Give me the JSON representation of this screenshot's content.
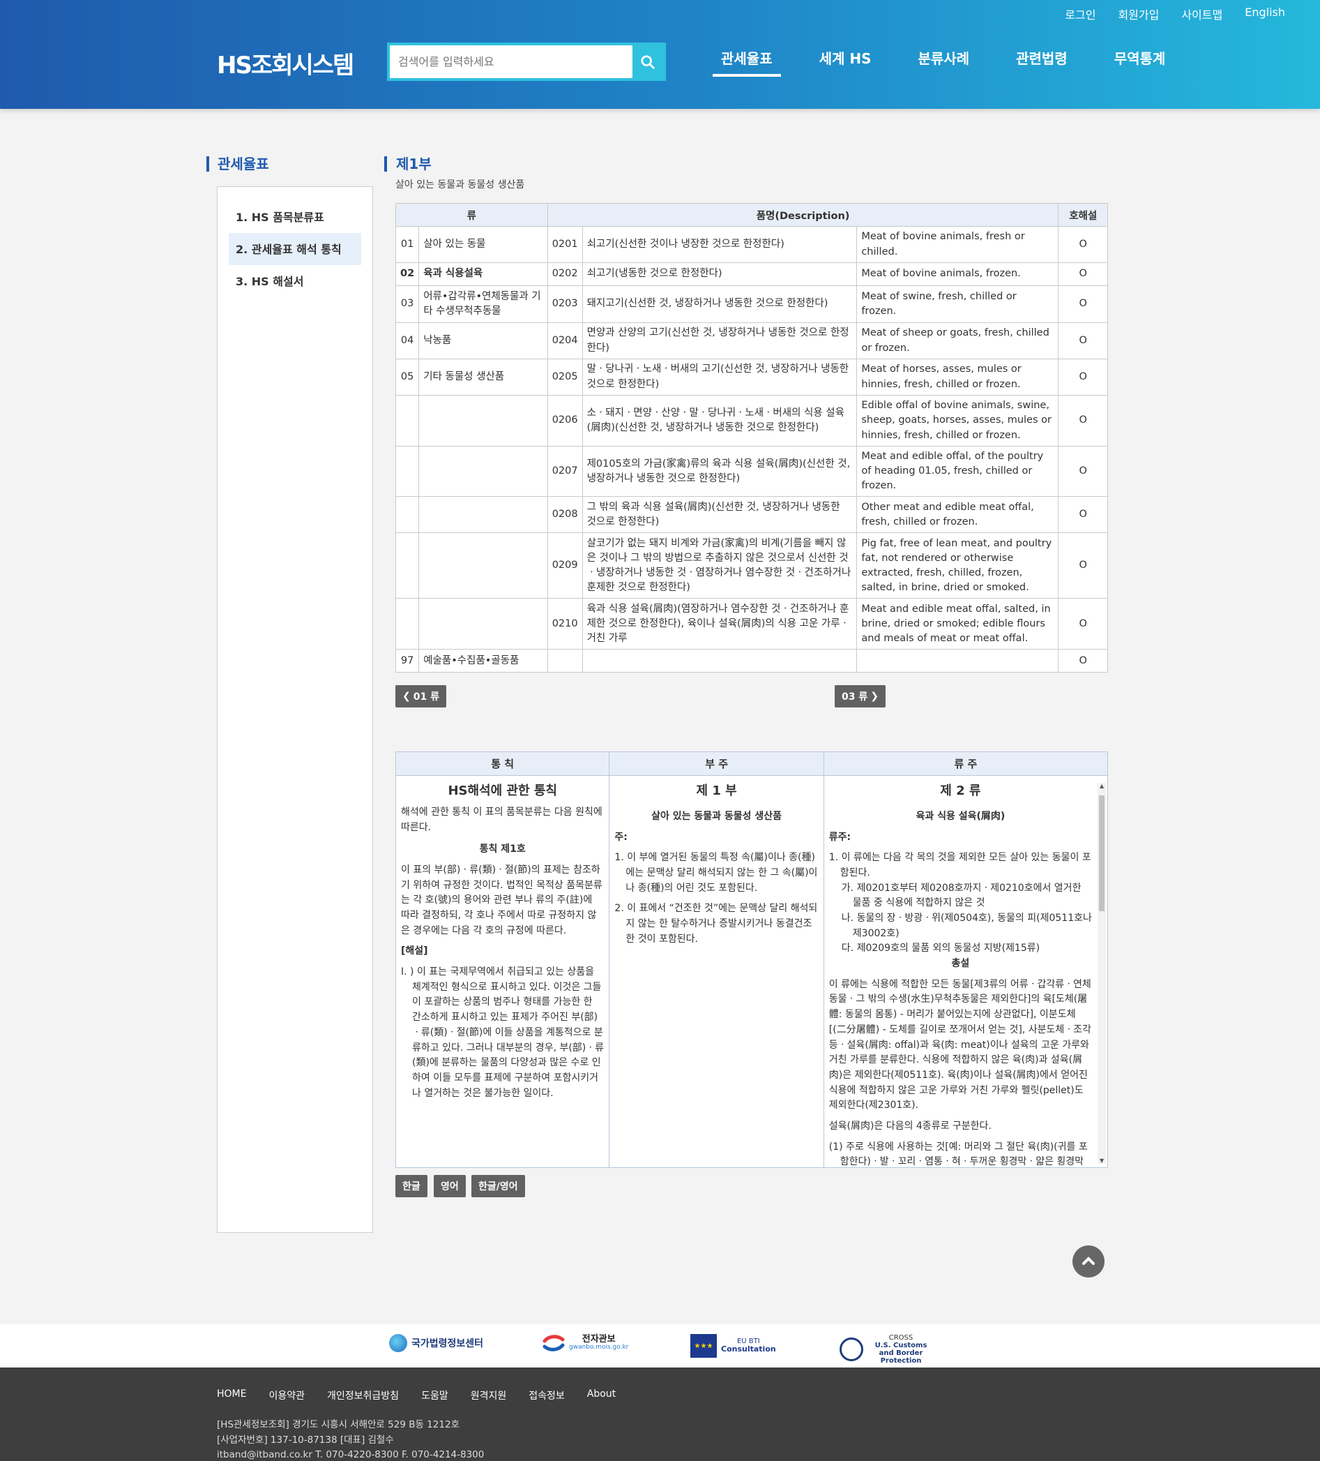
{
  "header": {
    "util": [
      "로그인",
      "회원가입",
      "사이트맵",
      "English"
    ],
    "logo": "HS조회시스템",
    "search_placeholder": "검색어를 입력하세요",
    "nav": [
      "관세율표",
      "세계 HS",
      "분류사례",
      "관련법령",
      "무역통계"
    ]
  },
  "sidebar": {
    "title": "관세율표",
    "items": [
      "1. HS 품목분류표",
      "2. 관세율표 해석 통칙",
      "3. HS 해설서"
    ]
  },
  "section": {
    "title": "제1부",
    "subtitle": "살아 있는 동물과 동물성 생산품"
  },
  "table": {
    "headers": [
      "류",
      "품명(Description)",
      "호해설"
    ],
    "rows": [
      {
        "n": "01",
        "cname": "살아 있는 동물",
        "code": "0201",
        "kr": "쇠고기(신선한 것이나 냉장한 것으로 한정한다)",
        "en": "Meat of bovine animals, fresh or chilled.",
        "mark": "O"
      },
      {
        "n": "02",
        "cname": "육과 식용설육",
        "code": "0202",
        "kr": "쇠고기(냉동한 것으로 한정한다)",
        "en": "Meat of bovine animals, frozen.",
        "mark": "O"
      },
      {
        "n": "03",
        "cname": "어류•갑각류•연체동물과 기타 수생무척추동물",
        "code": "0203",
        "kr": "돼지고기(신선한 것, 냉장하거나 냉동한 것으로 한정한다)",
        "en": "Meat of swine, fresh, chilled or frozen.",
        "mark": "O"
      },
      {
        "n": "04",
        "cname": "낙농품",
        "code": "0204",
        "kr": "면양과 산양의 고기(신선한 것, 냉장하거나 냉동한 것으로 한정한다)",
        "en": "Meat of sheep or goats, fresh, chilled or frozen.",
        "mark": "O"
      },
      {
        "n": "05",
        "cname": "기타 동물성 생산품",
        "code": "0205",
        "kr": "말ㆍ당나귀ㆍ노새ㆍ버새의 고기(신선한 것, 냉장하거나 냉동한 것으로 한정한다)",
        "en": "Meat of horses, asses, mules or hinnies, fresh, chilled or frozen.",
        "mark": "O"
      },
      {
        "n": "",
        "cname": "",
        "code": "0206",
        "kr": "소ㆍ돼지ㆍ면양ㆍ산양ㆍ말ㆍ당나귀ㆍ노새ㆍ버새의 식용 설육(屑肉)(신선한 것, 냉장하거나 냉동한 것으로 한정한다)",
        "en": "Edible offal of bovine animals, swine, sheep, goats, horses, asses, mules or hinnies, fresh, chilled or frozen.",
        "mark": "O"
      },
      {
        "n": "",
        "cname": "",
        "code": "0207",
        "kr": "제0105호의 가금(家禽)류의 육과 식용 설육(屑肉)(신선한 것, 냉장하거나 냉동한 것으로 한정한다)",
        "en": "Meat and edible offal, of the poultry of heading 01.05, fresh, chilled or frozen.",
        "mark": "O"
      },
      {
        "n": "",
        "cname": "",
        "code": "0208",
        "kr": "그 밖의 육과 식용 설육(屑肉)(신선한 것, 냉장하거나 냉동한 것으로 한정한다)",
        "en": "Other meat and edible meat offal, fresh, chilled or frozen.",
        "mark": "O"
      },
      {
        "n": "",
        "cname": "",
        "code": "0209",
        "kr": "살코기가 없는 돼지 비계와 가금(家禽)의 비계(기름을 빼지 않은 것이나 그 밖의 방법으로 추출하지 않은 것으로서 신선한 것ㆍ냉장하거나 냉동한 것ㆍ염장하거나 염수장한 것ㆍ건조하거나 훈제한 것으로 한정한다)",
        "en": "Pig fat, free of lean meat, and poultry fat, not rendered or otherwise extracted, fresh, chilled, frozen, salted, in brine, dried or smoked.",
        "mark": "O"
      },
      {
        "n": "",
        "cname": "",
        "code": "0210",
        "kr": "육과 식용 설육(屑肉)(염장하거나 염수장한 것ㆍ건조하거나 훈제한 것으로 한정한다), 육이나 설육(屑肉)의 식용 고운 가루ㆍ거친 가루",
        "en": "Meat and edible meat offal, salted, in brine, dried or smoked; edible flours and meals of meat or meat offal.",
        "mark": "O"
      },
      {
        "n": "97",
        "cname": "예술품•수집품•골동품",
        "code": "",
        "kr": "",
        "en": "",
        "mark": "O"
      }
    ]
  },
  "pager": {
    "prev": "01 류",
    "next": "03 류"
  },
  "panels": {
    "heads": [
      "통 칙",
      "부 주",
      "류 주"
    ],
    "general": {
      "title": "HS해석에 관한 통칙",
      "intro": "해석에 관한 통칙 이 표의 품목분류는 다음 원칙에 따른다.",
      "rule_title": "통칙 제1호",
      "rule_text": "이 표의 부(部)ㆍ류(類)ㆍ절(節)의 표제는 참조하기 위하여 규정한 것이다. 법적인 목적상 품목분류는 각 호(號)의 용어와 관련 부나 류의 주(註)에 따라 결정하되, 각 호나 주에서 따로 규정하지 않은 경우에는 다음 각 호의 규정에 따른다.",
      "note_label": "[해설]",
      "note_text": "I. ) 이 표는 국제무역에서 취급되고 있는 상품을 체계적인 형식으로 표시하고 있다. 이것은 그들이 포괄하는 상품의 범주나 형태를 가능한 한 간소하게 표시하고 있는 표제가 주어진 부(部)ㆍ류(類)ㆍ절(節)에 이들 상품을 계통적으로 분류하고 있다. 그러나 대부분의 경우, 부(部)ㆍ류(類)에 분류하는 물품의 다양성과 많은 수로 인하여 이들 모두를 표제에 구분하여 포함시키거나 열거하는 것은 불가능한 일이다."
    },
    "section_note": {
      "title": "제 1 부",
      "subtitle": "살아 있는 동물과 동물성 생산품",
      "label": "주:",
      "items": [
        "1. 이 부에 열거된 동물의 특정 속(屬)이나 종(種)에는 문맥상 달리 해석되지 않는 한 그 속(屬)이나 종(種)의 어린 것도 포함된다.",
        "2. 이 표에서 “건조한 것”에는 문맥상 달리 해석되지 않는 한 탈수하거나 증발시키거나 동결건조한 것이 포함된다."
      ]
    },
    "chapter_note": {
      "title": "제 2 류",
      "subtitle": "육과 식용 설육(屑肉)",
      "label": "류주:",
      "item1": "1. 이 류에는 다음 각 목의 것을 제외한 모든 살아 있는 동물이 포함된다.",
      "subitems": [
        "가. 제0201호부터 제0208호까지ㆍ제0210호에서 열거한 물품 중 식용에 적합하지 않은 것",
        "나. 동물의 장ㆍ방광ㆍ위(제0504호), 동물의 피(제0511호나 제3002호)",
        "다. 제0209호의 물품 외의 동물성 지방(제15류)"
      ],
      "general_label": "총설",
      "para1": "이 류에는 식용에 적합한 모든 동물[제3류의 어류ㆍ갑각류ㆍ연체동물ㆍ그 밖의 수생(水生)무척추동물은 제외한다]의 육[도체(屠體: 동물의 몸통) - 머리가 붙어있는지에 상관없다], 이분도체[(二分屠體) - 도체를 길이로 쪼개어서 얻는 것], 사분도체ㆍ조각 등ㆍ설육(屑肉: offal)과 육(肉: meat)이나 설육의 고운 가루와 거친 가루를 분류한다. 식용에 적합하지 않은 육(肉)과 설육(屑肉)은 제외한다(제0511호). 육(肉)이나 설육(屑肉)에서 얻어진 식용에 적합하지 않은 고운 가루와 거친 가루와 펠릿(pellet)도 제외한다(제2301호).",
      "para2": "설육(屑肉)은 다음의 4종류로 구분한다.",
      "para3": "(1) 주로 식용에 사용하는 것[예: 머리와 그 절단 육(肉)(귀를 포함한다)ㆍ발ㆍ꼬리ㆍ염통ㆍ혀ㆍ두꺼운 횡경막ㆍ얇은 횡경막"
    }
  },
  "lang_buttons": [
    "한글",
    "영어",
    "한글/영어"
  ],
  "partners": [
    {
      "name": "국가법령정보센터"
    },
    {
      "name": "전자관보",
      "sub": "gwanbo.mois.go.kr"
    },
    {
      "name": "Consultation",
      "pre": "EU BTI"
    },
    {
      "name": "U.S. Customs and Border Protection",
      "pre": "CROSS"
    }
  ],
  "footer": {
    "nav": [
      "HOME",
      "이용약관",
      "개인정보취급방침",
      "도움말",
      "원격지원",
      "접속정보",
      "About"
    ],
    "lines": [
      "[HS관세정보조회]  경기도 시흥시 서해안로 529 B동 1212호",
      "[사업자번호]  137-10-87138   [대표]  김철수",
      "itband@itband.co.kr   T. 070-4220-8300    F. 070-4214-8300"
    ]
  },
  "colors": {
    "brand": "#1f5aad",
    "accent": "#2fc1de",
    "footer": "#3e3e3e"
  }
}
